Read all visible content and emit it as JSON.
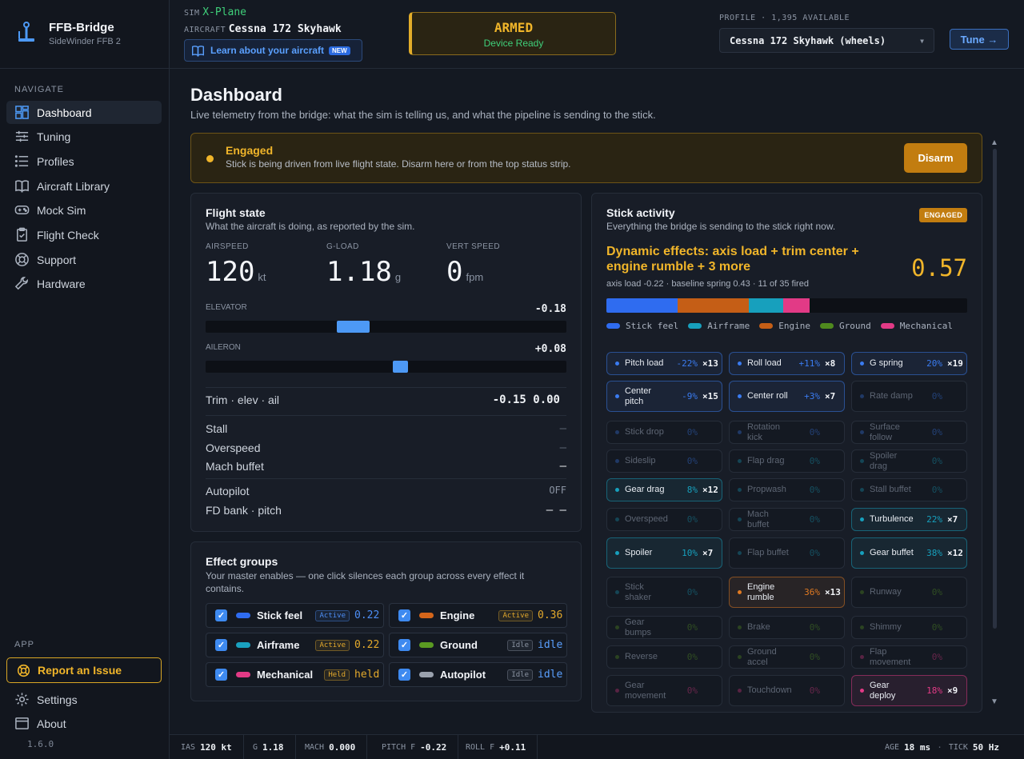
{
  "brand": {
    "title": "FFB-Bridge",
    "subtitle": "SideWinder FFB 2"
  },
  "nav": {
    "heading": "NAVIGATE",
    "items": [
      {
        "label": "Dashboard"
      },
      {
        "label": "Tuning"
      },
      {
        "label": "Profiles"
      },
      {
        "label": "Aircraft Library"
      },
      {
        "label": "Mock Sim"
      },
      {
        "label": "Flight Check"
      },
      {
        "label": "Support"
      },
      {
        "label": "Hardware"
      }
    ]
  },
  "app": {
    "heading": "APP",
    "report": "Report an Issue",
    "settings": "Settings",
    "about": "About",
    "version": "1.6.0"
  },
  "topbar": {
    "sim_label": "SIM",
    "sim_value": "X-Plane",
    "aircraft_label": "AIRCRAFT",
    "aircraft_value": "Cessna 172 Skyhawk",
    "learn": "Learn about your aircraft",
    "learn_badge": "NEW",
    "armed": "ARMED",
    "armed_sub": "Device Ready",
    "profile_label": "PROFILE · 1,395 AVAILABLE",
    "profile_value": "Cessna 172 Skyhawk (wheels)",
    "tune": "Tune →"
  },
  "page": {
    "title": "Dashboard",
    "subtitle": "Live telemetry from the bridge: what the sim is telling us, and what the pipeline is sending to the stick."
  },
  "engaged": {
    "title": "Engaged",
    "desc": "Stick is being driven from live flight state. Disarm here or from the top status strip.",
    "button": "Disarm"
  },
  "flight": {
    "title": "Flight state",
    "subtitle": "What the aircraft is doing, as reported by the sim.",
    "airspeed_label": "AIRSPEED",
    "airspeed": "120",
    "airspeed_unit": "kt",
    "gload_label": "G-LOAD",
    "gload": "1.18",
    "gload_unit": "g",
    "vs_label": "VERT SPEED",
    "vs": "0",
    "vs_unit": "fpm",
    "elevator_label": "ELEVATOR",
    "elevator": "-0.18",
    "elevator_value": -0.18,
    "aileron_label": "AILERON",
    "aileron": "+0.08",
    "aileron_value": 0.08,
    "trim_label": "Trim · elev · ail",
    "trim": "-0.15 0.00",
    "stall_label": "Stall",
    "stall": "—",
    "overspeed_label": "Overspeed",
    "overspeed": "—",
    "mach_label": "Mach buffet",
    "mach": "—",
    "autopilot_label": "Autopilot",
    "autopilot": "OFF",
    "fd_label": "FD bank · pitch",
    "fd": "— —"
  },
  "groups": {
    "title": "Effect groups",
    "subtitle": "Your master enables — one click silences each group across every effect it contains.",
    "items": [
      {
        "name": "Stick feel",
        "badge": "Active",
        "value": "0.22",
        "color": "#2f6cf0",
        "badge_color": "#4d8ef5",
        "value_color": "#4d8ef5"
      },
      {
        "name": "Engine",
        "badge": "Active",
        "value": "0.36",
        "color": "#d4651a",
        "badge_color": "#e3a92c",
        "value_color": "#e3a92c"
      },
      {
        "name": "Airframe",
        "badge": "Active",
        "value": "0.22",
        "color": "#1aa1c0",
        "badge_color": "#e3a92c",
        "value_color": "#e3a92c"
      },
      {
        "name": "Ground",
        "badge": "Idle",
        "value": "idle",
        "color": "#5a9a22",
        "badge_color": "#8b94a3",
        "value_color": "#5aa0ff"
      },
      {
        "name": "Mechanical",
        "badge": "Held",
        "value": "held",
        "color": "#e23a86",
        "badge_color": "#e3a92c",
        "value_color": "#e3a92c"
      },
      {
        "name": "Autopilot",
        "badge": "Idle",
        "value": "idle",
        "color": "#9aa1ad",
        "badge_color": "#8b94a3",
        "value_color": "#5aa0ff"
      }
    ]
  },
  "stick": {
    "title": "Stick activity",
    "subtitle": "Everything the bridge is sending to the stick right now.",
    "tag": "ENGAGED",
    "dynamic": "Dynamic effects: axis load + trim center + engine rumble + 3 more",
    "value": "0.57",
    "detail": "axis load -0.22 · baseline spring 0.43 · 11 of 35 fired",
    "bar": [
      {
        "share": 0.197,
        "color": "#2f6cf0"
      },
      {
        "share": 0.197,
        "color": "#c55e16"
      },
      {
        "share": 0.097,
        "color": "#17a0bd"
      },
      {
        "share": 0.073,
        "color": "#e23a86"
      }
    ],
    "legend": [
      {
        "name": "Stick feel",
        "color": "#2f6cf0"
      },
      {
        "name": "Airframe",
        "color": "#17a0bd"
      },
      {
        "name": "Engine",
        "color": "#c55e16"
      },
      {
        "name": "Ground",
        "color": "#4f8a1e"
      },
      {
        "name": "Mechanical",
        "color": "#e23a86"
      }
    ]
  },
  "effects": [
    {
      "name": "Pitch load",
      "pct": "-22%",
      "count": "×13",
      "g": "s",
      "on": true
    },
    {
      "name": "Roll load",
      "pct": "+11%",
      "count": "×8",
      "g": "s",
      "on": true
    },
    {
      "name": "G spring",
      "pct": "20%",
      "count": "×19",
      "g": "s",
      "on": true
    },
    {
      "name": "Center pitch",
      "pct": "-9%",
      "count": "×15",
      "g": "s",
      "on": true
    },
    {
      "name": "Center roll",
      "pct": "+3%",
      "count": "×7",
      "g": "s",
      "on": true
    },
    {
      "name": "Rate damp",
      "pct": "0%",
      "count": "",
      "g": "s",
      "on": false
    },
    {
      "name": "Stick drop",
      "pct": "0%",
      "count": "",
      "g": "s",
      "on": false
    },
    {
      "name": "Rotation kick",
      "pct": "0%",
      "count": "",
      "g": "s",
      "on": false
    },
    {
      "name": "Surface follow",
      "pct": "0%",
      "count": "",
      "g": "s",
      "on": false
    },
    {
      "name": "Sideslip",
      "pct": "0%",
      "count": "",
      "g": "s",
      "on": false
    },
    {
      "name": "Flap drag",
      "pct": "0%",
      "count": "",
      "g": "a",
      "on": false
    },
    {
      "name": "Spoiler drag",
      "pct": "0%",
      "count": "",
      "g": "a",
      "on": false
    },
    {
      "name": "Gear drag",
      "pct": "8%",
      "count": "×12",
      "g": "a",
      "on": true
    },
    {
      "name": "Propwash",
      "pct": "0%",
      "count": "",
      "g": "a",
      "on": false
    },
    {
      "name": "Stall buffet",
      "pct": "0%",
      "count": "",
      "g": "a",
      "on": false
    },
    {
      "name": "Overspeed",
      "pct": "0%",
      "count": "",
      "g": "a",
      "on": false
    },
    {
      "name": "Mach buffet",
      "pct": "0%",
      "count": "",
      "g": "a",
      "on": false
    },
    {
      "name": "Turbulence",
      "pct": "22%",
      "count": "×7",
      "g": "a",
      "on": true
    },
    {
      "name": "Spoiler",
      "pct": "10%",
      "count": "×7",
      "g": "a",
      "on": true
    },
    {
      "name": "Flap buffet",
      "pct": "0%",
      "count": "",
      "g": "a",
      "on": false
    },
    {
      "name": "Gear buffet",
      "pct": "38%",
      "count": "×12",
      "g": "a",
      "on": true
    },
    {
      "name": "Stick shaker",
      "pct": "0%",
      "count": "",
      "g": "a",
      "on": false
    },
    {
      "name": "Engine rumble",
      "pct": "36%",
      "count": "×13",
      "g": "e",
      "on": true
    },
    {
      "name": "Runway",
      "pct": "0%",
      "count": "",
      "g": "g",
      "on": false
    },
    {
      "name": "Gear bumps",
      "pct": "0%",
      "count": "",
      "g": "g",
      "on": false
    },
    {
      "name": "Brake",
      "pct": "0%",
      "count": "",
      "g": "g",
      "on": false
    },
    {
      "name": "Shimmy",
      "pct": "0%",
      "count": "",
      "g": "g",
      "on": false
    },
    {
      "name": "Reverse",
      "pct": "0%",
      "count": "",
      "g": "g",
      "on": false
    },
    {
      "name": "Ground accel",
      "pct": "0%",
      "count": "",
      "g": "g",
      "on": false
    },
    {
      "name": "Flap movement",
      "pct": "0%",
      "count": "",
      "g": "m",
      "on": false
    },
    {
      "name": "Gear movement",
      "pct": "0%",
      "count": "",
      "g": "m",
      "on": false
    },
    {
      "name": "Touchdown",
      "pct": "0%",
      "count": "",
      "g": "m",
      "on": false
    },
    {
      "name": "Gear deploy",
      "pct": "18%",
      "count": "×9",
      "g": "m",
      "on": true
    }
  ],
  "effect_colors": {
    "s": "#3a7bf0",
    "a": "#17a0bd",
    "e": "#e07a22",
    "g": "#5a9a22",
    "m": "#e23a86"
  },
  "status": {
    "ias_label": "IAS",
    "ias": "120 kt",
    "g_label": "G",
    "g": "1.18",
    "mach_label": "MACH",
    "mach": "0.000",
    "pitchf_label": "PITCH F",
    "pitchf": "-0.22",
    "rollf_label": "ROLL F",
    "rollf": "+0.11",
    "age_label": "AGE",
    "age": "18 ms",
    "tick_label": "TICK",
    "tick": "50 Hz"
  }
}
